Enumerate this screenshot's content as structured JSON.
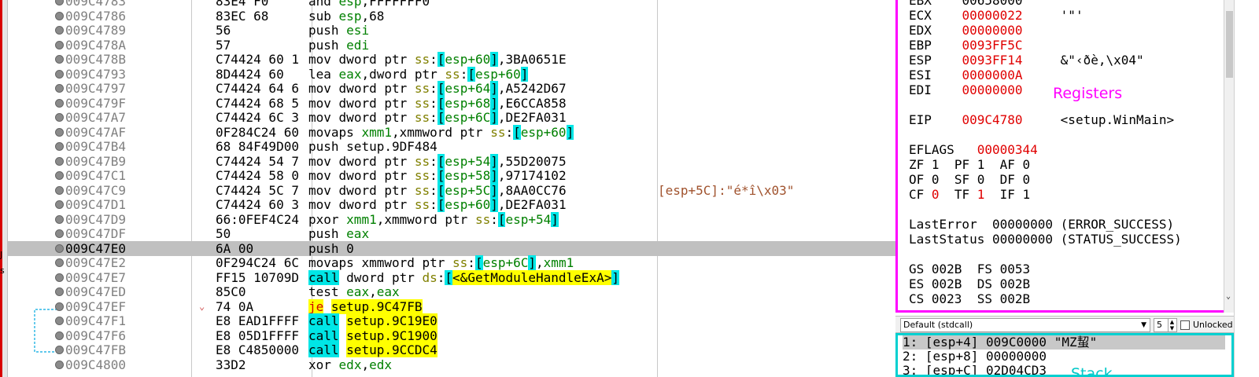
{
  "colors": {
    "register_border": "#ff00ff",
    "stack_border": "#00d0d0",
    "highlight_call": "#00e6e6",
    "highlight_address": "#ffff00",
    "changed_register": "#e00000"
  },
  "left_edge": {
    "chars": [
      "J",
      "s"
    ]
  },
  "disasm": {
    "rows": [
      {
        "addr": "009C4783",
        "bytes": "83E4 F0",
        "mnemonic": "and",
        "operands": "esp,FFFFFFF0",
        "comment": ""
      },
      {
        "addr": "009C4786",
        "bytes": "83EC 68",
        "mnemonic": "sub",
        "operands": "esp,68",
        "comment": ""
      },
      {
        "addr": "009C4789",
        "bytes": "56",
        "mnemonic": "push",
        "operands": "esi",
        "comment": ""
      },
      {
        "addr": "009C478A",
        "bytes": "57",
        "mnemonic": "push",
        "operands": "edi",
        "comment": ""
      },
      {
        "addr": "009C478B",
        "bytes": "C74424 60 1",
        "mnemonic": "mov",
        "operands": "dword ptr ss:[esp+60],3BA0651E",
        "comment": ""
      },
      {
        "addr": "009C4793",
        "bytes": "8D4424 60",
        "mnemonic": "lea",
        "operands": "eax,dword ptr ss:[esp+60]",
        "comment": ""
      },
      {
        "addr": "009C4797",
        "bytes": "C74424 64 6",
        "mnemonic": "mov",
        "operands": "dword ptr ss:[esp+64],A5242D67",
        "comment": ""
      },
      {
        "addr": "009C479F",
        "bytes": "C74424 68 5",
        "mnemonic": "mov",
        "operands": "dword ptr ss:[esp+68],E6CCA858",
        "comment": ""
      },
      {
        "addr": "009C47A7",
        "bytes": "C74424 6C 3",
        "mnemonic": "mov",
        "operands": "dword ptr ss:[esp+6C],DE2FA031",
        "comment": ""
      },
      {
        "addr": "009C47AF",
        "bytes": "0F284C24 60",
        "mnemonic": "movaps",
        "operands": "xmm1,xmmword ptr ss:[esp+60]",
        "comment": ""
      },
      {
        "addr": "009C47B4",
        "bytes": "68 84F49D00",
        "mnemonic": "push",
        "operands": "setup.9DF484",
        "comment": ""
      },
      {
        "addr": "009C47B9",
        "bytes": "C74424 54 7",
        "mnemonic": "mov",
        "operands": "dword ptr ss:[esp+54],55D20075",
        "comment": ""
      },
      {
        "addr": "009C47C1",
        "bytes": "C74424 58 0",
        "mnemonic": "mov",
        "operands": "dword ptr ss:[esp+58],97174102",
        "comment": ""
      },
      {
        "addr": "009C47C9",
        "bytes": "C74424 5C 7",
        "mnemonic": "mov",
        "operands": "dword ptr ss:[esp+5C],8AA0CC76",
        "comment": "[esp+5C]:\"é*î\\x03\""
      },
      {
        "addr": "009C47D1",
        "bytes": "C74424 60 3",
        "mnemonic": "mov",
        "operands": "dword ptr ss:[esp+60],DE2FA031",
        "comment": ""
      },
      {
        "addr": "009C47D9",
        "bytes": "66:0FEF4C24",
        "mnemonic": "pxor",
        "operands": "xmm1,xmmword ptr ss:[esp+54]",
        "comment": ""
      },
      {
        "addr": "009C47DF",
        "bytes": "50",
        "mnemonic": "push",
        "operands": "eax",
        "comment": ""
      },
      {
        "addr": "009C47E0",
        "bytes": "6A 00",
        "mnemonic": "push",
        "operands": "0",
        "comment": "",
        "selected": true
      },
      {
        "addr": "009C47E2",
        "bytes": "0F294C24 6C",
        "mnemonic": "movaps",
        "operands": "xmmword ptr ss:[esp+6C],xmm1",
        "comment": ""
      },
      {
        "addr": "009C47E7",
        "bytes": "FF15 10709D",
        "mnemonic": "call",
        "operands": "dword ptr ds:[<&GetModuleHandleExA>]",
        "comment": ""
      },
      {
        "addr": "009C47ED",
        "bytes": "85C0",
        "mnemonic": "test",
        "operands": "eax,eax",
        "comment": ""
      },
      {
        "addr": "009C47EF",
        "bytes": "74 0A",
        "mnemonic": "je",
        "operands": "setup.9C47FB",
        "comment": ""
      },
      {
        "addr": "009C47F1",
        "bytes": "E8 EAD1FFFF",
        "mnemonic": "call",
        "operands": "setup.9C19E0",
        "comment": ""
      },
      {
        "addr": "009C47F6",
        "bytes": "E8 05D1FFFF",
        "mnemonic": "call",
        "operands": "setup.9C1900",
        "comment": ""
      },
      {
        "addr": "009C47FB",
        "bytes": "E8 C4850000",
        "mnemonic": "call",
        "operands": "setup.9CCDC4",
        "comment": ""
      },
      {
        "addr": "009C4800",
        "bytes": "33D2",
        "mnemonic": "xor",
        "operands": "edx,edx",
        "comment": ""
      }
    ]
  },
  "registers": {
    "title": "Registers",
    "gprs": [
      {
        "name": "EBX",
        "value": "00658000",
        "comment": "",
        "changed": false
      },
      {
        "name": "ECX",
        "value": "00000022",
        "comment": "'\"'",
        "changed": true
      },
      {
        "name": "EDX",
        "value": "00000000",
        "comment": "",
        "changed": true
      },
      {
        "name": "EBP",
        "value": "0093FF5C",
        "comment": "",
        "changed": true
      },
      {
        "name": "ESP",
        "value": "0093FF14",
        "comment": "&\"‹ðè,\\x04\"",
        "changed": true
      },
      {
        "name": "ESI",
        "value": "0000000A",
        "comment": "",
        "changed": true
      },
      {
        "name": "EDI",
        "value": "00000000",
        "comment": "",
        "changed": true
      }
    ],
    "eip": {
      "name": "EIP",
      "value": "009C4780",
      "comment": "<setup.WinMain>"
    },
    "eflags": {
      "name": "EFLAGS",
      "value": "00000344"
    },
    "flags": [
      [
        {
          "n": "ZF",
          "v": "1",
          "c": false
        },
        {
          "n": "PF",
          "v": "1",
          "c": false
        },
        {
          "n": "AF",
          "v": "0",
          "c": false
        }
      ],
      [
        {
          "n": "OF",
          "v": "0",
          "c": false
        },
        {
          "n": "SF",
          "v": "0",
          "c": false
        },
        {
          "n": "DF",
          "v": "0",
          "c": false
        }
      ],
      [
        {
          "n": "CF",
          "v": "0",
          "c": true
        },
        {
          "n": "TF",
          "v": "1",
          "c": true
        },
        {
          "n": "IF",
          "v": "1",
          "c": false
        }
      ]
    ],
    "last_error": {
      "name": "LastError",
      "value": "00000000 (ERROR_SUCCESS)"
    },
    "last_status": {
      "name": "LastStatus",
      "value": "00000000 (STATUS_SUCCESS)"
    },
    "segs": [
      [
        {
          "n": "GS",
          "v": "002B"
        },
        {
          "n": "FS",
          "v": "0053"
        }
      ],
      [
        {
          "n": "ES",
          "v": "002B"
        },
        {
          "n": "DS",
          "v": "002B"
        }
      ],
      [
        {
          "n": "CS",
          "v": "0023"
        },
        {
          "n": "SS",
          "v": "002B"
        }
      ]
    ]
  },
  "stack_controls": {
    "convention": "Default (stdcall)",
    "count": "5",
    "unlock_label": "Unlocked"
  },
  "stack": {
    "title": "Stack",
    "rows": [
      {
        "idx": "1:",
        "loc": "[esp+4]",
        "value": "009C0000",
        "comment": "\"MZ蛪\"",
        "selected": true
      },
      {
        "idx": "2:",
        "loc": "[esp+8]",
        "value": "00000000",
        "comment": "",
        "selected": false
      },
      {
        "idx": "3:",
        "loc": "[esp+C]",
        "value": "02D04CD3",
        "comment": "",
        "selected": false
      }
    ]
  }
}
